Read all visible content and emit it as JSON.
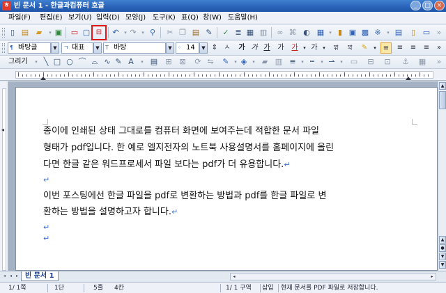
{
  "window": {
    "app_icon": "ㅎ",
    "title": "빈 문서 1 - 한글과컴퓨터 호글",
    "buttons": {
      "minimize": "_",
      "maximize": "□",
      "close": "×"
    }
  },
  "menu": {
    "items": [
      "파일(F)",
      "편집(E)",
      "보기(U)",
      "입력(D)",
      "모양(J)",
      "도구(K)",
      "표(Q)",
      "창(W)",
      "도움말(H)"
    ]
  },
  "format_bar": {
    "style": "바탕글",
    "language": "대표",
    "font": "바탕",
    "size": "14"
  },
  "drawing_bar": {
    "label": "그리기"
  },
  "document": {
    "paragraphs": [
      {
        "lines": [
          "  종이에 인쇄된 상태 그대로를 컴퓨터 화면에 보여주는데 적합한 문서 파일",
          "형태가 pdf입니다. 한 예로 엘지전자의 노트북 사용설명서를 홈페이지에 올린",
          "다면 한글 같은 워드프로세서 파일 보다는 pdf가 더 유용합니다."
        ]
      },
      {
        "lines": [
          "  이번 포스팅에선 한글 파일을 pdf로 변환하는 방법과 pdf를 한글 파일로 변",
          "환하는 방법을 설명하고자 합니다."
        ]
      }
    ],
    "return_mark": "↵"
  },
  "tabs": {
    "active_doc": "빈 문서 1"
  },
  "status": {
    "page": "1/ 1쪽",
    "column": "1단",
    "line": "5줄",
    "col_pos": "4칸",
    "section": "1/ 1 구역",
    "mode": "삽입",
    "message": "현재 문서를 PDF 파일로 저장합니다."
  },
  "colors": {
    "title_bar": "#2a62b8",
    "highlight_box": "#e01818",
    "return_mark": "#3b6fd0"
  },
  "icons": {
    "toolbar_main": [
      "new-doc-icon",
      "open-template-icon",
      "open-icon",
      "save-icon",
      "print-icon",
      "print-preview-icon",
      "save-as-pdf-icon",
      "undo-icon",
      "redo-icon",
      "find-icon",
      "cut-icon",
      "copy-icon",
      "paste-icon",
      "format-copy-icon",
      "spell-icon",
      "char-shape-icon",
      "para-shape-icon",
      "hyperlink-icon",
      "table-icon",
      "chart-icon",
      "picture-icon",
      "draw-object-icon",
      "columns-icon"
    ]
  }
}
